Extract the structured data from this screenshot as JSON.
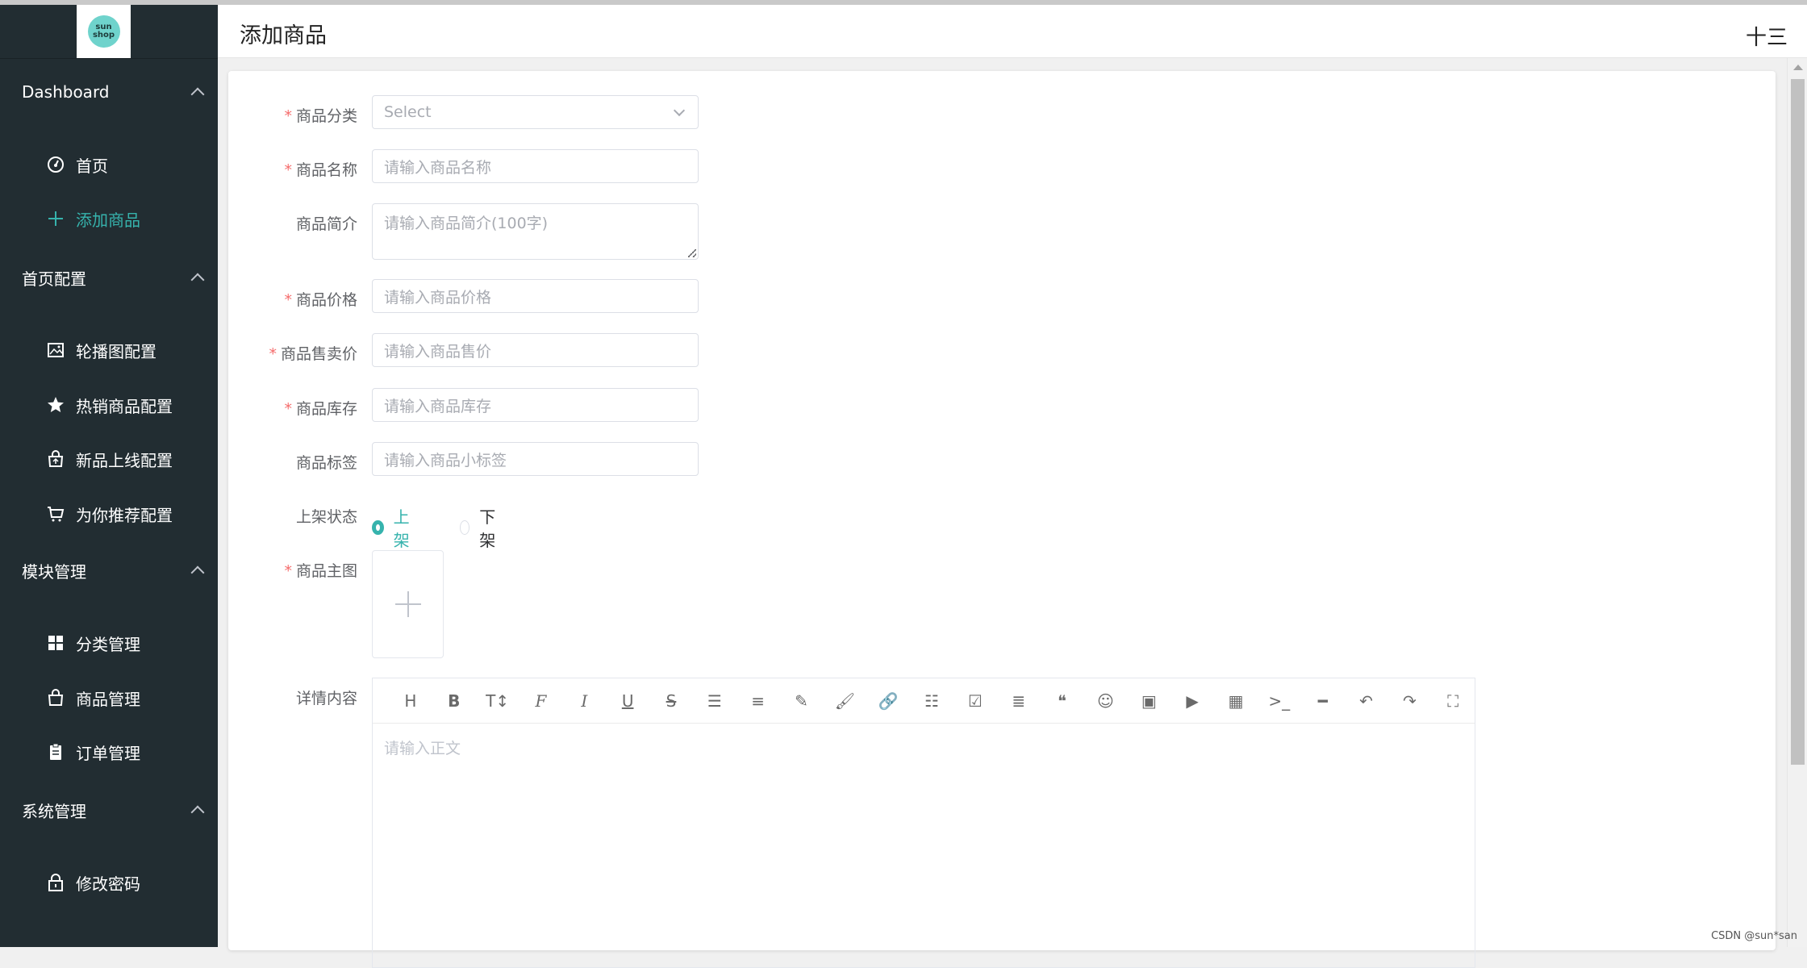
{
  "app": {
    "logo_text": "sun shop"
  },
  "sidebar": {
    "groups": [
      {
        "title": "Dashboard",
        "items": [
          {
            "label": "首页",
            "icon": "dashboard-gauge-icon"
          },
          {
            "label": "添加商品",
            "icon": "plus-icon",
            "active": true
          }
        ]
      },
      {
        "title": "首页配置",
        "items": [
          {
            "label": "轮播图配置",
            "icon": "picture-icon"
          },
          {
            "label": "热销商品配置",
            "icon": "star-icon"
          },
          {
            "label": "新品上线配置",
            "icon": "sell-bag-icon"
          },
          {
            "label": "为你推荐配置",
            "icon": "cart-icon"
          }
        ]
      },
      {
        "title": "模块管理",
        "items": [
          {
            "label": "分类管理",
            "icon": "grid-icon"
          },
          {
            "label": "商品管理",
            "icon": "goods-bag-icon"
          },
          {
            "label": "订单管理",
            "icon": "clipboard-icon"
          }
        ]
      },
      {
        "title": "系统管理",
        "items": [
          {
            "label": "修改密码",
            "icon": "lock-icon"
          }
        ]
      }
    ],
    "accent_color": "#36b3ad",
    "background_color": "#222d32"
  },
  "header": {
    "title": "添加商品",
    "user": "十三"
  },
  "form": {
    "category": {
      "label": "商品分类",
      "placeholder": "Select",
      "required": true
    },
    "name": {
      "label": "商品名称",
      "placeholder": "请输入商品名称",
      "required": true
    },
    "intro": {
      "label": "商品简介",
      "placeholder": "请输入商品简介(100字)",
      "required": false
    },
    "price": {
      "label": "商品价格",
      "placeholder": "请输入商品价格",
      "required": true
    },
    "sell_price": {
      "label": "商品售卖价",
      "placeholder": "请输入商品售价",
      "required": true
    },
    "stock": {
      "label": "商品库存",
      "placeholder": "请输入商品库存",
      "required": true
    },
    "tag": {
      "label": "商品标签",
      "placeholder": "请输入商品小标签",
      "required": false
    },
    "status": {
      "label": "上架状态",
      "options": [
        "上架",
        "下架"
      ],
      "selected": "上架"
    },
    "main_image": {
      "label": "商品主图",
      "required": true
    },
    "detail": {
      "label": "详情内容",
      "placeholder": "请输入正文"
    }
  },
  "editor_toolbar": [
    "heading-icon",
    "bold-icon",
    "font-size-icon",
    "font-family-icon",
    "italic-icon",
    "underline-icon",
    "strikethrough-icon",
    "indent-icon",
    "line-height-icon",
    "font-color-icon",
    "background-color-icon",
    "link-icon",
    "bullet-list-icon",
    "todo-icon",
    "justify-icon",
    "quote-icon",
    "emoji-icon",
    "image-icon",
    "video-icon",
    "table-icon",
    "code-icon",
    "divider-icon",
    "undo-icon",
    "redo-icon",
    "fullscreen-icon"
  ],
  "watermark": "CSDN @sun*san"
}
